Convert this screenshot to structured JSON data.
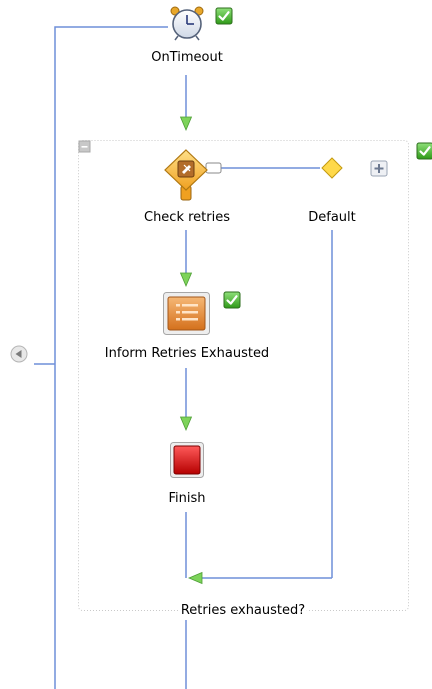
{
  "nodes": {
    "on_timeout": {
      "label": "OnTimeout",
      "icon": "alarm-clock-icon",
      "status": "valid"
    },
    "check_retries": {
      "label": "Check retries",
      "icon": "switch-decision-icon"
    },
    "default_branch": {
      "label": "Default",
      "icon": "diamond-case-icon"
    },
    "inform": {
      "label": "Inform Retries Exhausted",
      "icon": "task-list-icon",
      "status": "valid"
    },
    "finish": {
      "label": "Finish",
      "icon": "stop-icon"
    },
    "scope": {
      "label": "Retries exhausted?",
      "status": "valid"
    }
  },
  "colors": {
    "connector": "#6f8fd9",
    "arrowhead": "#7dd35a",
    "check_green": "#3aa51f",
    "finish_red": "#d21414",
    "switch_orange": "#f4b63c"
  }
}
